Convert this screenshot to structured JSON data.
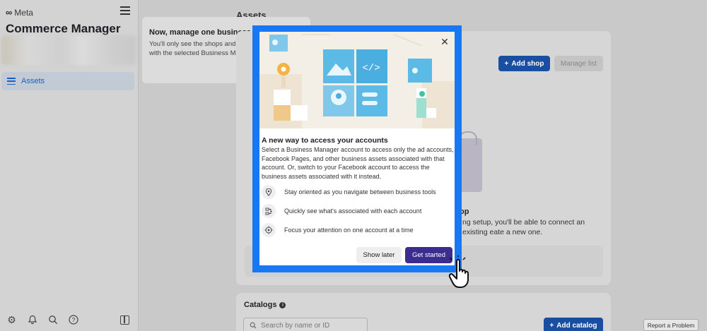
{
  "sidebar": {
    "brand": "Meta",
    "app_title": "Commerce Manager",
    "nav_items": [
      {
        "label": "Assets"
      }
    ],
    "bottom_icons": [
      "gear-icon",
      "bell-icon",
      "search-icon",
      "help-icon"
    ]
  },
  "tooltip": {
    "title": "Now, manage one business at a time",
    "body_line1": "You'll only see the shops and catalogs",
    "body_line2": "with the selected Business Manager."
  },
  "main": {
    "heading": "Assets",
    "shops": {
      "add_label": "Add shop",
      "manage_label": "Manage list",
      "empty_heading": "op",
      "empty_text": "ng setup, you'll be able to connect an existing eate a new one."
    },
    "catalogs": {
      "title": "Catalogs",
      "search_placeholder": "Search by name or ID",
      "add_label": "Add catalog"
    },
    "report_label": "Report a Problem"
  },
  "modal": {
    "title": "A new way to access your accounts",
    "description": "Select a Business Manager account to access only the ad accounts, Facebook Pages, and other business assets associated with that account. Or, switch to your Facebook account to access the business assets associated with it instead.",
    "features": [
      {
        "icon": "location-pin-icon",
        "text": "Stay oriented as you navigate between business tools"
      },
      {
        "icon": "hierarchy-icon",
        "text": "Quickly see what's associated with each account"
      },
      {
        "icon": "target-icon",
        "text": "Focus your attention on one account at a time"
      }
    ],
    "secondary_button": "Show later",
    "primary_button": "Get started"
  },
  "colors": {
    "modal_frame": "#1877f2",
    "primary_button": "#3a2d8f",
    "accent_blue": "#1a4ea0"
  }
}
